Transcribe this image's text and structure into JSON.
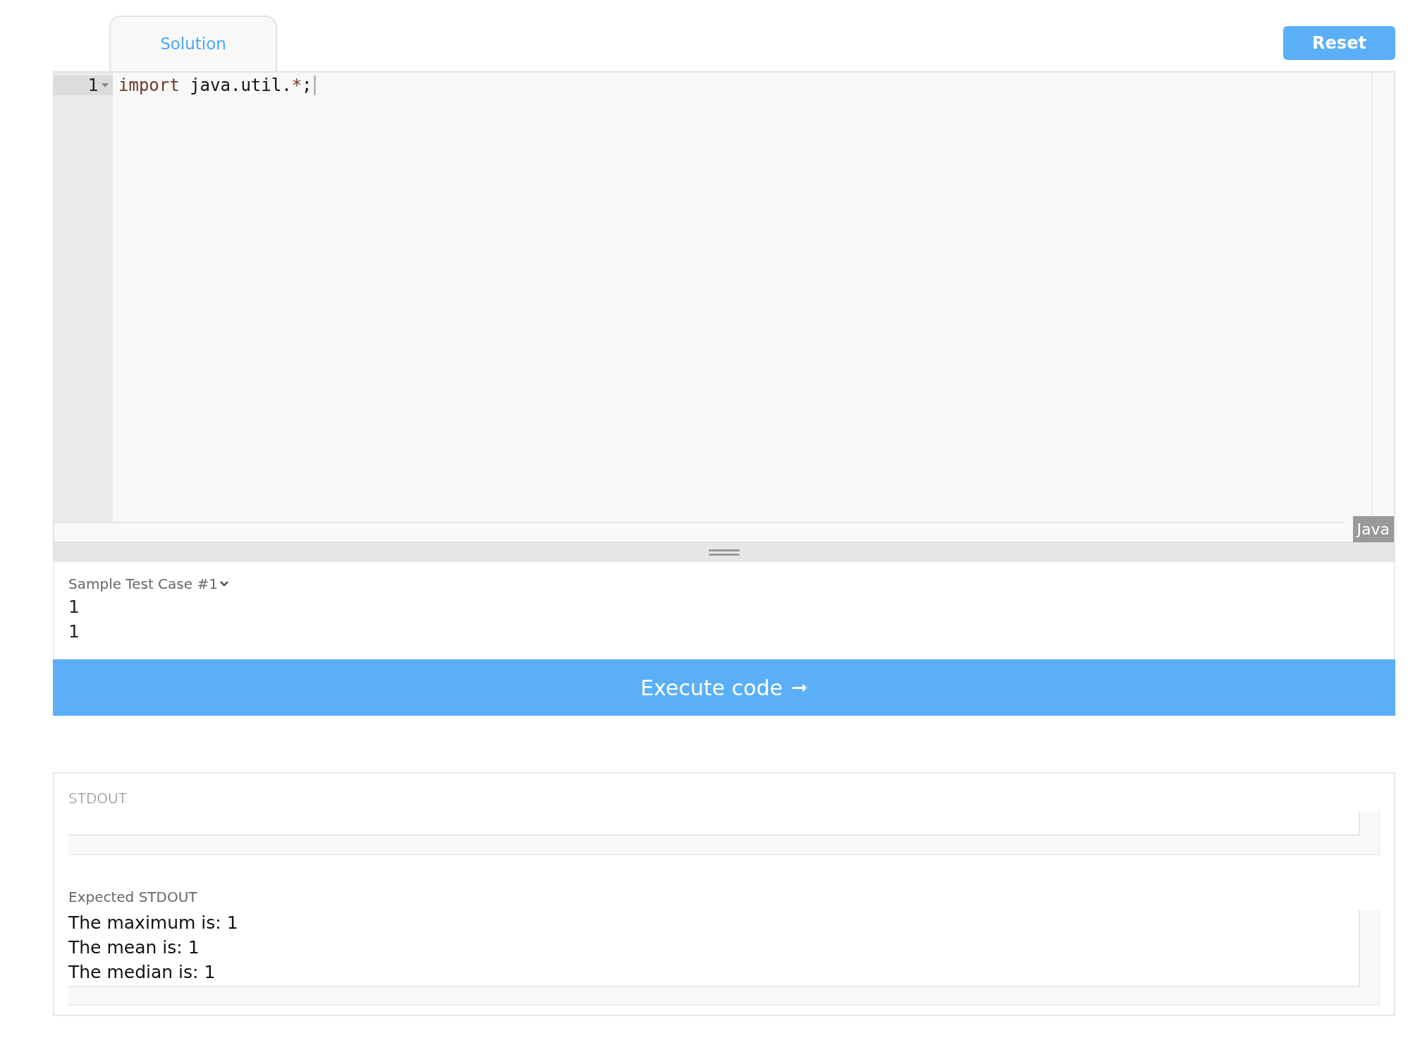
{
  "tabs": [
    {
      "label": "Solution",
      "selected": true
    }
  ],
  "reset_button": "Reset",
  "editor": {
    "lines": [
      {
        "number": "1",
        "foldable": true,
        "tokens": [
          {
            "text": "import",
            "kind": "keyword"
          },
          {
            "text": " java.util.",
            "kind": "plain"
          },
          {
            "text": "*",
            "kind": "operator"
          },
          {
            "text": ";",
            "kind": "plain"
          }
        ]
      }
    ],
    "language": "Java"
  },
  "test_case": {
    "label": "Sample Test Case #1",
    "input_lines": [
      "1",
      "1"
    ]
  },
  "execute_button": {
    "label": "Execute code",
    "arrow": "➞"
  },
  "output": {
    "stdout_label": "STDOUT",
    "expected_label": "Expected STDOUT",
    "expected_lines": [
      "The maximum is: 1",
      "The mean is: 1",
      "The median is: 1"
    ]
  }
}
